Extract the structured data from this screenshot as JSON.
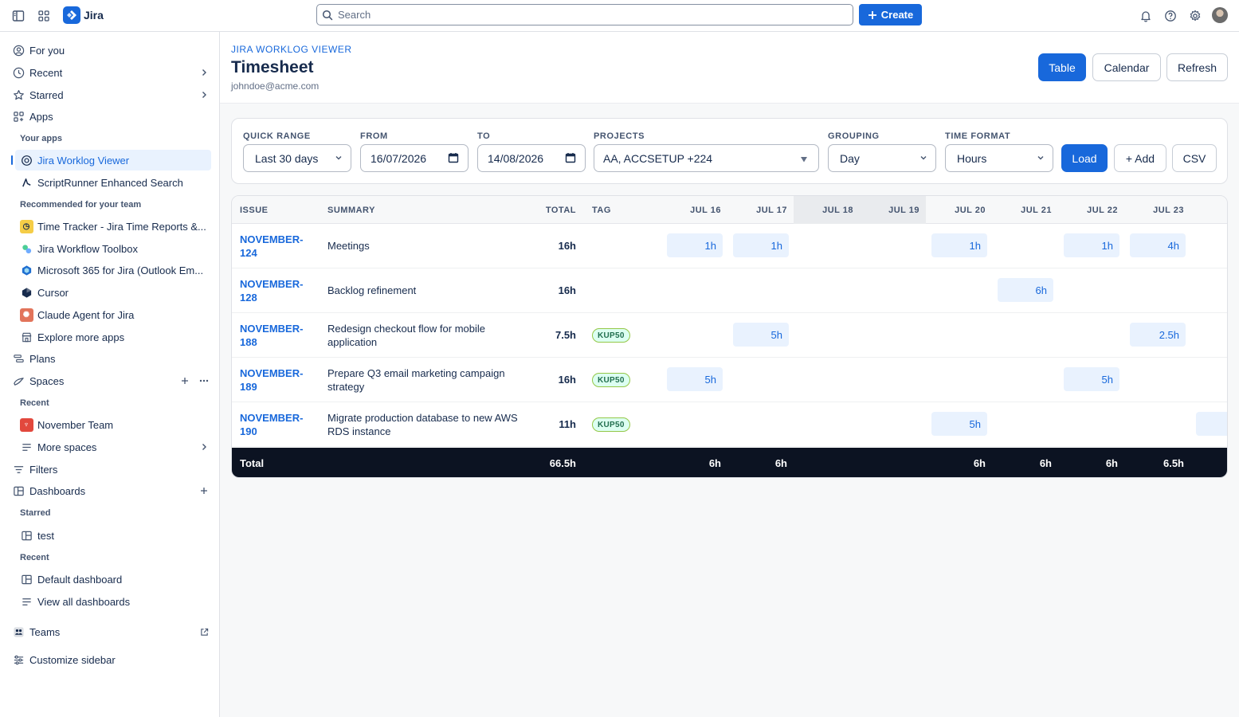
{
  "topnav": {
    "brand": "Jira",
    "search_placeholder": "Search",
    "create_label": "Create"
  },
  "sidebar": {
    "for_you": "For you",
    "recent": "Recent",
    "starred": "Starred",
    "apps": "Apps",
    "your_apps_heading": "Your apps",
    "active_app": "Jira Worklog Viewer",
    "scriptrunner": "ScriptRunner Enhanced Search",
    "recommended_heading": "Recommended for your team",
    "recommended": [
      "Time Tracker - Jira Time Reports &...",
      "Jira Workflow Toolbox",
      "Microsoft 365 for Jira (Outlook Em...",
      "Cursor",
      "Claude Agent for Jira"
    ],
    "explore": "Explore more apps",
    "plans": "Plans",
    "spaces": "Spaces",
    "spaces_recent_heading": "Recent",
    "november_team": "November Team",
    "more_spaces": "More spaces",
    "filters": "Filters",
    "dashboards": "Dashboards",
    "dash_starred_heading": "Starred",
    "dash_test": "test",
    "dash_recent_heading": "Recent",
    "default_dashboard": "Default dashboard",
    "view_all_dashboards": "View all dashboards",
    "teams": "Teams",
    "customize": "Customize sidebar"
  },
  "header": {
    "eyebrow": "JIRA WORKLOG VIEWER",
    "title": "Timesheet",
    "email": "johndoe@acme.com",
    "table_btn": "Table",
    "calendar_btn": "Calendar",
    "refresh_btn": "Refresh"
  },
  "filters": {
    "quick_range_label": "QUICK RANGE",
    "quick_range_value": "Last 30 days",
    "from_label": "FROM",
    "from_value": "16/07/2026",
    "to_label": "TO",
    "to_value": "14/08/2026",
    "projects_label": "PROJECTS",
    "projects_value": "AA, ACCSETUP +224",
    "grouping_label": "GROUPING",
    "grouping_value": "Day",
    "time_format_label": "TIME FORMAT",
    "time_format_value": "Hours",
    "load_btn": "Load",
    "add_btn": "+ Add",
    "csv_btn": "CSV"
  },
  "table": {
    "headers": {
      "issue": "ISSUE",
      "summary": "SUMMARY",
      "total": "TOTAL",
      "tag": "TAG",
      "days": [
        "JUL 16",
        "JUL 17",
        "JUL 18",
        "JUL 19",
        "JUL 20",
        "JUL 21",
        "JUL 22",
        "JUL 23",
        "JU"
      ]
    },
    "rows": [
      {
        "key": "NOVEMBER-124",
        "key_l1": "NOVEMBER-",
        "key_l2": "124",
        "summary": "Meetings",
        "total": "16h",
        "tag": "",
        "cells": [
          "1h",
          "1h",
          "",
          "",
          "1h",
          "",
          "1h",
          "4h"
        ]
      },
      {
        "key": "NOVEMBER-128",
        "key_l1": "NOVEMBER-",
        "key_l2": "128",
        "summary": "Backlog refinement",
        "total": "16h",
        "tag": "",
        "cells": [
          "",
          "",
          "",
          "",
          "",
          "6h",
          "",
          ""
        ]
      },
      {
        "key": "NOVEMBER-188",
        "key_l1": "NOVEMBER-",
        "key_l2": "188",
        "summary": "Redesign checkout flow for mobile application",
        "total": "7.5h",
        "tag": "KUP50",
        "cells": [
          "",
          "5h",
          "",
          "",
          "",
          "",
          "",
          "2.5h"
        ]
      },
      {
        "key": "NOVEMBER-189",
        "key_l1": "NOVEMBER-",
        "key_l2": "189",
        "summary": "Prepare Q3 email marketing campaign strategy",
        "total": "16h",
        "tag": "KUP50",
        "cells": [
          "5h",
          "",
          "",
          "",
          "",
          "",
          "5h",
          ""
        ]
      },
      {
        "key": "NOVEMBER-190",
        "key_l1": "NOVEMBER-",
        "key_l2": "190",
        "summary": "Migrate production database to new AWS RDS instance",
        "total": "11h",
        "tag": "KUP50",
        "cells": [
          "",
          "",
          "",
          "",
          "5h",
          "",
          "",
          ""
        ]
      }
    ],
    "footer": {
      "label": "Total",
      "total": "66.5h",
      "days": [
        "6h",
        "6h",
        "",
        "",
        "6h",
        "6h",
        "6h",
        "6.5h"
      ]
    }
  },
  "colors": {
    "accent": "#1868db",
    "footer_bg": "#0c1322",
    "cell_bg": "#e9f2fe",
    "tag_bg": "#dcfff1"
  }
}
